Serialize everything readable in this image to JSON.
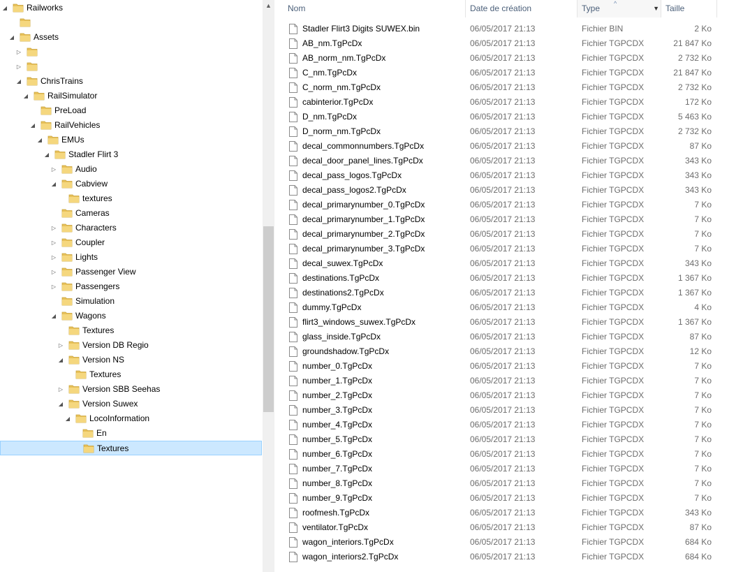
{
  "tree": {
    "items": [
      {
        "label": "Railworks",
        "level": 0,
        "arrow": "open"
      },
      {
        "label": "",
        "level": 1,
        "arrow": "none"
      },
      {
        "label": "Assets",
        "level": 1,
        "arrow": "open"
      },
      {
        "label": "",
        "level": 2,
        "arrow": "closed"
      },
      {
        "label": "",
        "level": 2,
        "arrow": "closed"
      },
      {
        "label": "ChrisTrains",
        "level": 2,
        "arrow": "open"
      },
      {
        "label": "RailSimulator",
        "level": 3,
        "arrow": "open"
      },
      {
        "label": "PreLoad",
        "level": 4,
        "arrow": "none"
      },
      {
        "label": "RailVehicles",
        "level": 4,
        "arrow": "open"
      },
      {
        "label": "EMUs",
        "level": 5,
        "arrow": "open"
      },
      {
        "label": "Stadler Flirt 3",
        "level": 6,
        "arrow": "open"
      },
      {
        "label": "Audio",
        "level": 7,
        "arrow": "closed"
      },
      {
        "label": "Cabview",
        "level": 7,
        "arrow": "open"
      },
      {
        "label": "textures",
        "level": 8,
        "arrow": "none"
      },
      {
        "label": "Cameras",
        "level": 7,
        "arrow": "none"
      },
      {
        "label": "Characters",
        "level": 7,
        "arrow": "closed"
      },
      {
        "label": "Coupler",
        "level": 7,
        "arrow": "closed"
      },
      {
        "label": "Lights",
        "level": 7,
        "arrow": "closed"
      },
      {
        "label": "Passenger View",
        "level": 7,
        "arrow": "closed"
      },
      {
        "label": "Passengers",
        "level": 7,
        "arrow": "closed"
      },
      {
        "label": "Simulation",
        "level": 7,
        "arrow": "none"
      },
      {
        "label": "Wagons",
        "level": 7,
        "arrow": "open"
      },
      {
        "label": "Textures",
        "level": 8,
        "arrow": "none"
      },
      {
        "label": "Version DB Regio",
        "level": 8,
        "arrow": "closed"
      },
      {
        "label": "Version NS",
        "level": 8,
        "arrow": "open"
      },
      {
        "label": "Textures",
        "level": 9,
        "arrow": "none"
      },
      {
        "label": "Version SBB Seehas",
        "level": 8,
        "arrow": "closed"
      },
      {
        "label": "Version Suwex",
        "level": 8,
        "arrow": "open"
      },
      {
        "label": "LocoInformation",
        "level": 9,
        "arrow": "open"
      },
      {
        "label": "En",
        "level": 10,
        "arrow": "none"
      },
      {
        "label": "Textures",
        "level": 10,
        "arrow": "none",
        "selected": true
      }
    ]
  },
  "columns": {
    "name": "Nom",
    "date": "Date de création",
    "type": "Type",
    "size": "Taille"
  },
  "files": [
    {
      "name": "Stadler Flirt3 Digits SUWEX.bin",
      "date": "06/05/2017 21:13",
      "type": "Fichier BIN",
      "size": "2 Ko"
    },
    {
      "name": "AB_nm.TgPcDx",
      "date": "06/05/2017 21:13",
      "type": "Fichier TGPCDX",
      "size": "21 847 Ko"
    },
    {
      "name": "AB_norm_nm.TgPcDx",
      "date": "06/05/2017 21:13",
      "type": "Fichier TGPCDX",
      "size": "2 732 Ko"
    },
    {
      "name": "C_nm.TgPcDx",
      "date": "06/05/2017 21:13",
      "type": "Fichier TGPCDX",
      "size": "21 847 Ko"
    },
    {
      "name": "C_norm_nm.TgPcDx",
      "date": "06/05/2017 21:13",
      "type": "Fichier TGPCDX",
      "size": "2 732 Ko"
    },
    {
      "name": "cabinterior.TgPcDx",
      "date": "06/05/2017 21:13",
      "type": "Fichier TGPCDX",
      "size": "172 Ko"
    },
    {
      "name": "D_nm.TgPcDx",
      "date": "06/05/2017 21:13",
      "type": "Fichier TGPCDX",
      "size": "5 463 Ko"
    },
    {
      "name": "D_norm_nm.TgPcDx",
      "date": "06/05/2017 21:13",
      "type": "Fichier TGPCDX",
      "size": "2 732 Ko"
    },
    {
      "name": "decal_commonnumbers.TgPcDx",
      "date": "06/05/2017 21:13",
      "type": "Fichier TGPCDX",
      "size": "87 Ko"
    },
    {
      "name": "decal_door_panel_lines.TgPcDx",
      "date": "06/05/2017 21:13",
      "type": "Fichier TGPCDX",
      "size": "343 Ko"
    },
    {
      "name": "decal_pass_logos.TgPcDx",
      "date": "06/05/2017 21:13",
      "type": "Fichier TGPCDX",
      "size": "343 Ko"
    },
    {
      "name": "decal_pass_logos2.TgPcDx",
      "date": "06/05/2017 21:13",
      "type": "Fichier TGPCDX",
      "size": "343 Ko"
    },
    {
      "name": "decal_primarynumber_0.TgPcDx",
      "date": "06/05/2017 21:13",
      "type": "Fichier TGPCDX",
      "size": "7 Ko"
    },
    {
      "name": "decal_primarynumber_1.TgPcDx",
      "date": "06/05/2017 21:13",
      "type": "Fichier TGPCDX",
      "size": "7 Ko"
    },
    {
      "name": "decal_primarynumber_2.TgPcDx",
      "date": "06/05/2017 21:13",
      "type": "Fichier TGPCDX",
      "size": "7 Ko"
    },
    {
      "name": "decal_primarynumber_3.TgPcDx",
      "date": "06/05/2017 21:13",
      "type": "Fichier TGPCDX",
      "size": "7 Ko"
    },
    {
      "name": "decal_suwex.TgPcDx",
      "date": "06/05/2017 21:13",
      "type": "Fichier TGPCDX",
      "size": "343 Ko"
    },
    {
      "name": "destinations.TgPcDx",
      "date": "06/05/2017 21:13",
      "type": "Fichier TGPCDX",
      "size": "1 367 Ko"
    },
    {
      "name": "destinations2.TgPcDx",
      "date": "06/05/2017 21:13",
      "type": "Fichier TGPCDX",
      "size": "1 367 Ko"
    },
    {
      "name": "dummy.TgPcDx",
      "date": "06/05/2017 21:13",
      "type": "Fichier TGPCDX",
      "size": "4 Ko"
    },
    {
      "name": "flirt3_windows_suwex.TgPcDx",
      "date": "06/05/2017 21:13",
      "type": "Fichier TGPCDX",
      "size": "1 367 Ko"
    },
    {
      "name": "glass_inside.TgPcDx",
      "date": "06/05/2017 21:13",
      "type": "Fichier TGPCDX",
      "size": "87 Ko"
    },
    {
      "name": "groundshadow.TgPcDx",
      "date": "06/05/2017 21:13",
      "type": "Fichier TGPCDX",
      "size": "12 Ko"
    },
    {
      "name": "number_0.TgPcDx",
      "date": "06/05/2017 21:13",
      "type": "Fichier TGPCDX",
      "size": "7 Ko"
    },
    {
      "name": "number_1.TgPcDx",
      "date": "06/05/2017 21:13",
      "type": "Fichier TGPCDX",
      "size": "7 Ko"
    },
    {
      "name": "number_2.TgPcDx",
      "date": "06/05/2017 21:13",
      "type": "Fichier TGPCDX",
      "size": "7 Ko"
    },
    {
      "name": "number_3.TgPcDx",
      "date": "06/05/2017 21:13",
      "type": "Fichier TGPCDX",
      "size": "7 Ko"
    },
    {
      "name": "number_4.TgPcDx",
      "date": "06/05/2017 21:13",
      "type": "Fichier TGPCDX",
      "size": "7 Ko"
    },
    {
      "name": "number_5.TgPcDx",
      "date": "06/05/2017 21:13",
      "type": "Fichier TGPCDX",
      "size": "7 Ko"
    },
    {
      "name": "number_6.TgPcDx",
      "date": "06/05/2017 21:13",
      "type": "Fichier TGPCDX",
      "size": "7 Ko"
    },
    {
      "name": "number_7.TgPcDx",
      "date": "06/05/2017 21:13",
      "type": "Fichier TGPCDX",
      "size": "7 Ko"
    },
    {
      "name": "number_8.TgPcDx",
      "date": "06/05/2017 21:13",
      "type": "Fichier TGPCDX",
      "size": "7 Ko"
    },
    {
      "name": "number_9.TgPcDx",
      "date": "06/05/2017 21:13",
      "type": "Fichier TGPCDX",
      "size": "7 Ko"
    },
    {
      "name": "roofmesh.TgPcDx",
      "date": "06/05/2017 21:13",
      "type": "Fichier TGPCDX",
      "size": "343 Ko"
    },
    {
      "name": "ventilator.TgPcDx",
      "date": "06/05/2017 21:13",
      "type": "Fichier TGPCDX",
      "size": "87 Ko"
    },
    {
      "name": "wagon_interiors.TgPcDx",
      "date": "06/05/2017 21:13",
      "type": "Fichier TGPCDX",
      "size": "684 Ko"
    },
    {
      "name": "wagon_interiors2.TgPcDx",
      "date": "06/05/2017 21:13",
      "type": "Fichier TGPCDX",
      "size": "684 Ko"
    }
  ],
  "colors": {
    "folder": "#e8c15a",
    "folder_dark": "#c9a23a",
    "selected_bg": "#cce8ff",
    "header_text": "#4c607a"
  }
}
